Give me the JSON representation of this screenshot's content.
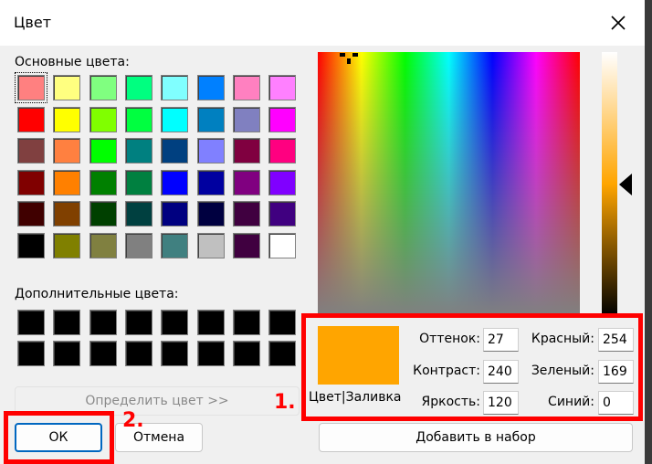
{
  "title": "Цвет",
  "basic_colors_label": "Основные цвета:",
  "custom_colors_label": "Дополнительные цвета:",
  "basic_colors": [
    "#ff8080",
    "#ffff80",
    "#80ff80",
    "#00ff80",
    "#80ffff",
    "#0080ff",
    "#ff80c0",
    "#ff80ff",
    "#ff0000",
    "#ffff00",
    "#80ff00",
    "#00ff40",
    "#00ffff",
    "#0080c0",
    "#8080c0",
    "#ff00ff",
    "#804040",
    "#ff8040",
    "#00ff00",
    "#008080",
    "#004080",
    "#8080ff",
    "#800040",
    "#ff0080",
    "#800000",
    "#ff8000",
    "#008000",
    "#008040",
    "#0000ff",
    "#0000a0",
    "#800080",
    "#8000ff",
    "#400000",
    "#804000",
    "#004000",
    "#004040",
    "#000080",
    "#000040",
    "#400040",
    "#400080",
    "#000000",
    "#808000",
    "#808040",
    "#808080",
    "#408080",
    "#c0c0c0",
    "#400040",
    "#ffffff"
  ],
  "custom_colors": [
    "#000000",
    "#000000",
    "#000000",
    "#000000",
    "#000000",
    "#000000",
    "#000000",
    "#000000",
    "#000000",
    "#000000",
    "#000000",
    "#000000",
    "#000000",
    "#000000",
    "#000000",
    "#000000"
  ],
  "define_button": "Определить цвет >>",
  "ok_button": "ОК",
  "cancel_button": "Отмена",
  "add_button": "Добавить в набор",
  "preview_color": "#ffa500",
  "preview_label": "Цвет|Заливка",
  "fields": {
    "hue_label": "Оттенок:",
    "hue": "27",
    "sat_label": "Контраст:",
    "sat": "240",
    "lum_label": "Яркость:",
    "lum": "120",
    "red_label": "Красный:",
    "red": "254",
    "green_label": "Зеленый:",
    "green": "169",
    "blue_label": "Синий:",
    "blue": "0"
  },
  "annotations": {
    "one": "1.",
    "two": "2."
  },
  "highlight_color": "#ff0000"
}
